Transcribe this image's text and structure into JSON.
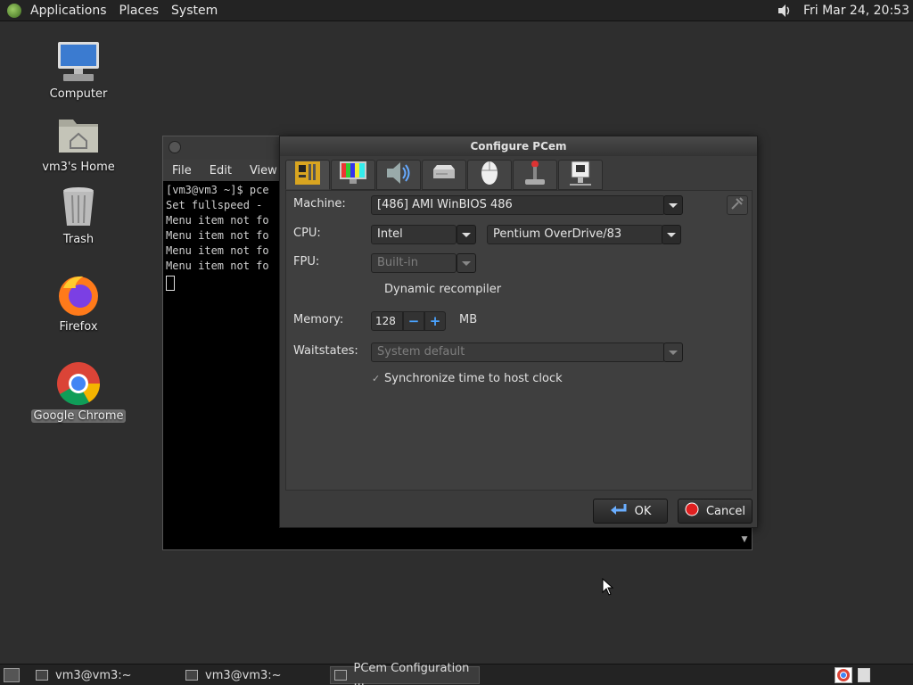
{
  "top_panel": {
    "menu": [
      "Applications",
      "Places",
      "System"
    ],
    "clock": "Fri Mar 24, 20:53"
  },
  "desktop_icons": [
    {
      "label": "Computer"
    },
    {
      "label": "vm3's Home"
    },
    {
      "label": "Trash"
    },
    {
      "label": "Firefox"
    },
    {
      "label": "Google Chrome"
    }
  ],
  "terminal": {
    "menu": [
      "File",
      "Edit",
      "View"
    ],
    "lines": [
      "[vm3@vm3 ~]$ pce",
      "Set fullspeed -",
      "Menu item not fo",
      "Menu item not fo",
      "Menu item not fo",
      "Menu item not fo"
    ]
  },
  "dialog": {
    "title": "Configure PCem",
    "tabs": [
      "machine",
      "display",
      "sound",
      "storage",
      "mouse",
      "joystick",
      "network"
    ],
    "machine_label": "Machine:",
    "machine_value": "[486] AMI WinBIOS 486",
    "cpu_label": "CPU:",
    "cpu_vendor": "Intel",
    "cpu_model": "Pentium OverDrive/83",
    "fpu_label": "FPU:",
    "fpu_value": "Built-in",
    "dynarec_label": "Dynamic recompiler",
    "memory_label": "Memory:",
    "memory_value": "128",
    "memory_unit": "MB",
    "spin_minus": "−",
    "spin_plus": "+",
    "waitstates_label": "Waitstates:",
    "waitstates_value": "System default",
    "sync_label": "Synchronize time to host clock",
    "sync_check": "✓",
    "ok_label": "OK",
    "cancel_label": "Cancel"
  },
  "taskbar": {
    "tasks": [
      "vm3@vm3:~",
      "vm3@vm3:~",
      "PCem Configuration ..."
    ]
  }
}
